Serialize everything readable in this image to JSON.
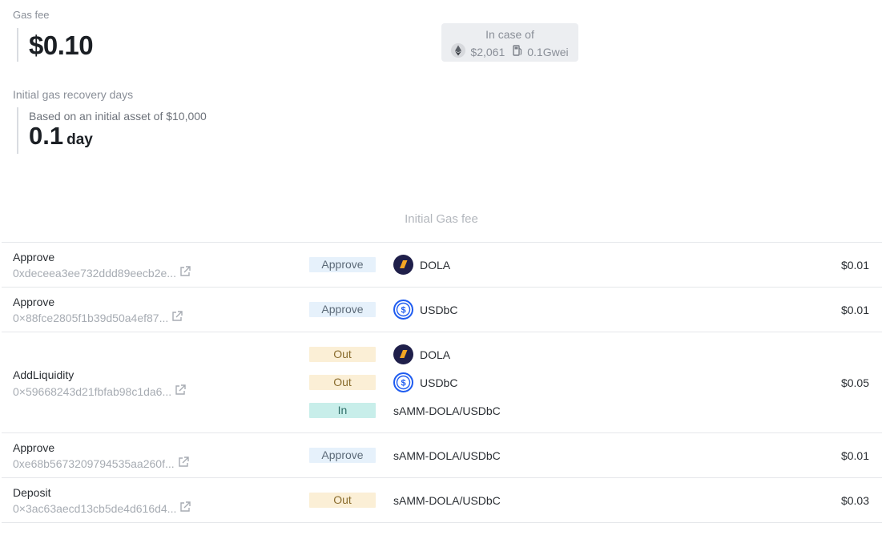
{
  "gas_fee": {
    "label": "Gas fee",
    "value": "$0.10"
  },
  "in_case_of": {
    "label": "In case of",
    "eth_price": "$2,061",
    "gas_price": "0.1Gwei",
    "eth_icon": "ethereum-icon",
    "gas_icon": "fuel-pump-icon"
  },
  "recovery": {
    "label": "Initial gas recovery days",
    "based_on": "Based on an initial asset of $10,000",
    "value": "0.1",
    "unit": "day"
  },
  "section_title": "Initial Gas fee",
  "colors": {
    "approve_bg": "#e6f1fb",
    "out_bg": "#fbefd6",
    "in_bg": "#c8eeea",
    "dola_bg": "#1f1f4a",
    "usdbc_blue": "#1f5cf0"
  },
  "transactions": [
    {
      "name": "Approve",
      "hash": "0xdeceea3ee732ddd89eecb2e...",
      "amount": "$0.01",
      "legs": [
        {
          "tag": "Approve",
          "token": "DOLA",
          "icon": "dola-icon"
        }
      ]
    },
    {
      "name": "Approve",
      "hash": "0×88fce2805f1b39d50a4ef87...",
      "amount": "$0.01",
      "legs": [
        {
          "tag": "Approve",
          "token": "USDbC",
          "icon": "usdbc-icon"
        }
      ]
    },
    {
      "name": "AddLiquidity",
      "hash": "0×59668243d21fbfab98c1da6...",
      "amount": "$0.05",
      "legs": [
        {
          "tag": "Out",
          "token": "DOLA",
          "icon": "dola-icon"
        },
        {
          "tag": "Out",
          "token": "USDbC",
          "icon": "usdbc-icon"
        },
        {
          "tag": "In",
          "token": "sAMM-DOLA/USDbC",
          "icon": ""
        }
      ]
    },
    {
      "name": "Approve",
      "hash": "0xe68b5673209794535aa260f...",
      "amount": "$0.01",
      "legs": [
        {
          "tag": "Approve",
          "token": "sAMM-DOLA/USDbC",
          "icon": ""
        }
      ]
    },
    {
      "name": "Deposit",
      "hash": "0×3ac63aecd13cb5de4d616d4...",
      "amount": "$0.03",
      "legs": [
        {
          "tag": "Out",
          "token": "sAMM-DOLA/USDbC",
          "icon": ""
        }
      ]
    }
  ]
}
